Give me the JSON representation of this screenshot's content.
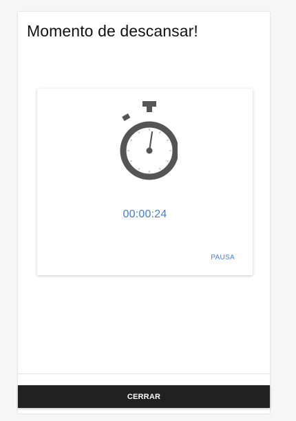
{
  "dialog": {
    "title": "Momento de descansar!"
  },
  "timer": {
    "elapsed": "00:00:24",
    "icon": "stopwatch-icon",
    "pause_label": "Pausa"
  },
  "footer": {
    "close_label": "Cerrar"
  },
  "colors": {
    "timer_text": "#3d7fd8",
    "icon_gray": "#555555",
    "close_button_bg": "#212121"
  }
}
